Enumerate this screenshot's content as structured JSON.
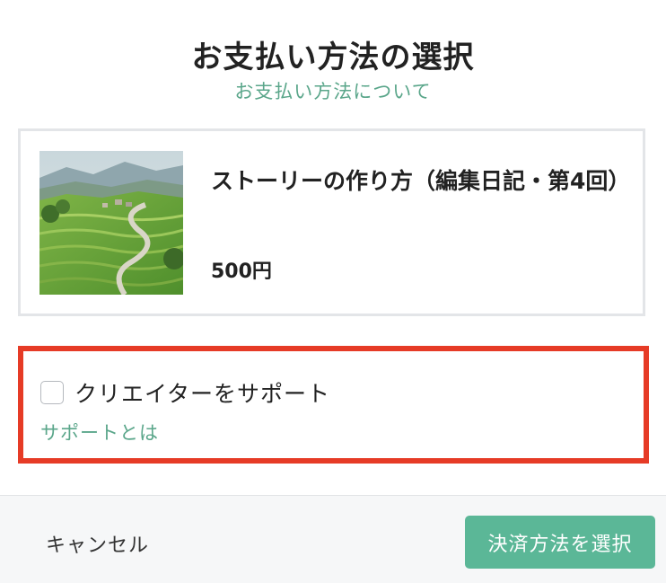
{
  "dialog": {
    "title": "お支払い方法の選択",
    "about_link": "お支払い方法について"
  },
  "product": {
    "title": "ストーリーの作り方（編集日記・第4回）",
    "price": "500円",
    "thumbnail": "rice-terraces-landscape"
  },
  "support": {
    "checkbox_label": "クリエイターをサポート",
    "checked": false,
    "link": "サポートとは"
  },
  "footer": {
    "cancel_label": "キャンセル",
    "submit_label": "決済方法を選択"
  },
  "colors": {
    "accent": "#5aa68a",
    "button": "#5bb797",
    "highlight_border": "#e63b26"
  }
}
